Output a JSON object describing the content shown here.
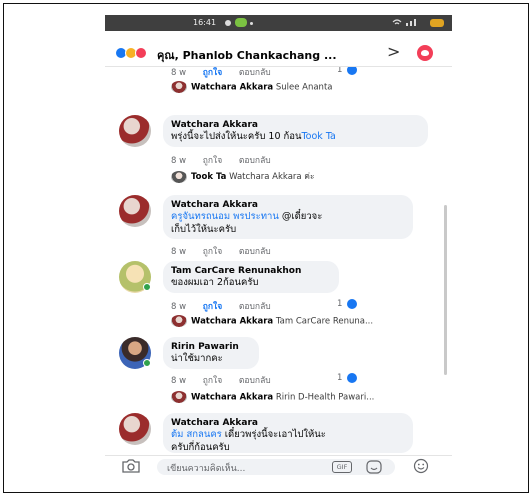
{
  "status_bar": {
    "time": "16:41"
  },
  "header": {
    "title": "คุณ, Phanlob Chankachang ...",
    "next_symbol": ">"
  },
  "comments": [
    {
      "partial_actions": {
        "time": "8 w",
        "like": "ถูกใจ",
        "reply": "ตอบกลับ",
        "like_count": "1"
      },
      "reply_preview": {
        "name": "Watchara Akkara",
        "text": "Sulee Ananta"
      }
    },
    {
      "name": "Watchara Akkara",
      "text_plain": "พรุ่งนี้จะไปส่งให้นะครับ 10 ก้อน",
      "text_mention": "Took Ta",
      "actions": {
        "time": "8 w",
        "like": "ถูกใจ",
        "reply": "ตอบกลับ"
      },
      "reply_preview": {
        "name": "Took Ta",
        "text": "Watchara Akkara ค่ะ"
      }
    },
    {
      "name": "Watchara Akkara",
      "text_mention": "ครูจันทรถนอม พรประทาน",
      "text_line1_rest": " @เดี๋ยวจะ",
      "text_line2": "เก็บไว้ให้นะครับ",
      "actions": {
        "time": "8 w",
        "like": "ถูกใจ",
        "reply": "ตอบกลับ"
      }
    },
    {
      "name": "Tam CarCare Renunakhon",
      "text_plain": "ของผมเอา 2ก้อนครับ",
      "actions": {
        "time": "8 w",
        "like": "ถูกใจ",
        "reply": "ตอบกลับ",
        "like_count": "1"
      },
      "reply_preview": {
        "name": "Watchara Akkara",
        "text": "Tam CarCare Renuna..."
      }
    },
    {
      "name": "Ririn Pawarin",
      "text_plain": "น่าใช้มากคะ",
      "actions": {
        "time": "8 w",
        "like": "ถูกใจ",
        "reply": "ตอบกลับ",
        "like_count": "1"
      },
      "reply_preview": {
        "name": "Watchara Akkara",
        "text": "Ririn D-Health Pawari..."
      }
    },
    {
      "name": "Watchara Akkara",
      "text_mention": "ต้ม สกลนคร",
      "text_line1_rest": " เดี๋ยวพรุ่งนี้จะเอาไปให้นะ",
      "text_line2": "ครับกี่ก้อนครับ"
    }
  ],
  "composer": {
    "placeholder": "เขียนความคิดเห็น...",
    "gif_label": "GIF"
  },
  "colors": {
    "link_blue": "#1877f2",
    "bubble_gray": "#f0f2f5",
    "online_green": "#31a24c",
    "status_bar": "#3f3f3f"
  }
}
